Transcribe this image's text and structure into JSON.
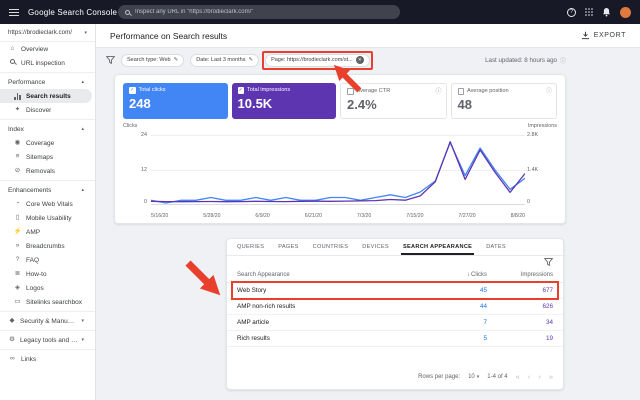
{
  "annotation_color": "#e8402c",
  "icons": {
    "chevron_up": "▴",
    "chevron_down": "▾",
    "edit": "✎",
    "close": "✕",
    "check": "✓",
    "sort_desc": "↓",
    "info": "ⓘ",
    "help": "?",
    "first": "«",
    "prev": "‹",
    "next": "›",
    "last": "»",
    "overview": "⌂",
    "discover": "✦",
    "coverage": "◉",
    "sitemaps": "≡",
    "removals": "⊘",
    "core_web_vitals": "◔",
    "mobile_usability": "▯",
    "amp": "⚡",
    "breadcrumbs": "»",
    "faq": "?",
    "how_to": "≣",
    "logos": "◈",
    "sitelinks": "▭",
    "security": "◆",
    "legacy": "⚙",
    "links": "∞"
  },
  "topbar": {
    "title": "Google Search Console",
    "search_placeholder": "Inspect any URL in \"https://brodieclark.com/\""
  },
  "sidebar": {
    "property": "https://brodieclark.com/",
    "items": {
      "overview": "Overview",
      "url_inspection": "URL inspection",
      "performance": "Performance",
      "search_results": "Search results",
      "discover": "Discover",
      "index": "Index",
      "coverage": "Coverage",
      "sitemaps": "Sitemaps",
      "removals": "Removals",
      "enhancements": "Enhancements",
      "core_web_vitals": "Core Web Vitals",
      "mobile_usability": "Mobile Usability",
      "amp": "AMP",
      "breadcrumbs": "Breadcrumbs",
      "faq": "FAQ",
      "how_to": "How-to",
      "logos": "Logos",
      "sitelinks_searchbox": "Sitelinks searchbox",
      "security": "Security & Manual Actions",
      "legacy": "Legacy tools and reports",
      "links": "Links"
    }
  },
  "header": {
    "title": "Performance on Search results",
    "export": "EXPORT"
  },
  "filters": {
    "chips": [
      {
        "label": "Search type: Web"
      },
      {
        "label": "Date: Last 3 months"
      },
      {
        "label": "Page: https://brodieclark.com/st..."
      }
    ],
    "last_updated": "Last updated: 8 hours ago"
  },
  "metrics": [
    {
      "label": "Total clicks",
      "value": "248",
      "checked": true,
      "color": "#4285f4"
    },
    {
      "label": "Total impressions",
      "value": "10.5K",
      "checked": true,
      "color": "#5e35b1"
    },
    {
      "label": "Average CTR",
      "value": "2.4%",
      "checked": false
    },
    {
      "label": "Average position",
      "value": "48",
      "checked": false
    }
  ],
  "chart_data": {
    "type": "line",
    "left_axis": {
      "label": "Clicks",
      "max": 24,
      "ticks": [
        "24",
        "12",
        "0"
      ]
    },
    "right_axis": {
      "label": "Impressions",
      "max": 2800,
      "ticks": [
        "2.8K",
        "1.4K",
        "0"
      ]
    },
    "x_labels": [
      "5/16/20",
      "5/28/20",
      "6/9/20",
      "6/21/20",
      "7/3/20",
      "7/15/20",
      "7/27/20",
      "8/8/20"
    ],
    "series": [
      {
        "name": "Clicks",
        "color": "#4285f4",
        "axis_max": 24,
        "values": [
          1,
          0,
          1,
          1,
          2,
          1,
          1,
          2,
          1,
          2,
          1,
          1,
          2,
          2,
          1,
          2,
          3,
          2,
          4,
          8,
          22,
          10,
          20,
          12,
          5,
          9
        ]
      },
      {
        "name": "Impressions",
        "color": "#5e35b1",
        "axis_max": 2800,
        "values": [
          70,
          60,
          55,
          60,
          65,
          55,
          60,
          70,
          65,
          60,
          70,
          75,
          70,
          80,
          90,
          100,
          150,
          120,
          300,
          900,
          2600,
          1000,
          2250,
          1300,
          450,
          1250
        ]
      }
    ],
    "legend_position": "none",
    "grid": true
  },
  "tabs": [
    {
      "label": "QUERIES"
    },
    {
      "label": "PAGES"
    },
    {
      "label": "COUNTRIES"
    },
    {
      "label": "DEVICES"
    },
    {
      "label": "SEARCH APPEARANCE"
    },
    {
      "label": "DATES"
    }
  ],
  "table": {
    "headers": {
      "name": "Search Appearance",
      "clicks": "Clicks",
      "impressions": "Impressions"
    },
    "rows": [
      {
        "name": "Web Story",
        "clicks": "45",
        "impressions": "677"
      },
      {
        "name": "AMP non-rich results",
        "clicks": "44",
        "impressions": "626"
      },
      {
        "name": "AMP article",
        "clicks": "7",
        "impressions": "34"
      },
      {
        "name": "Rich results",
        "clicks": "5",
        "impressions": "19"
      }
    ]
  },
  "pagination": {
    "label": "Rows per page:",
    "value": "10",
    "range": "1-4 of 4"
  }
}
